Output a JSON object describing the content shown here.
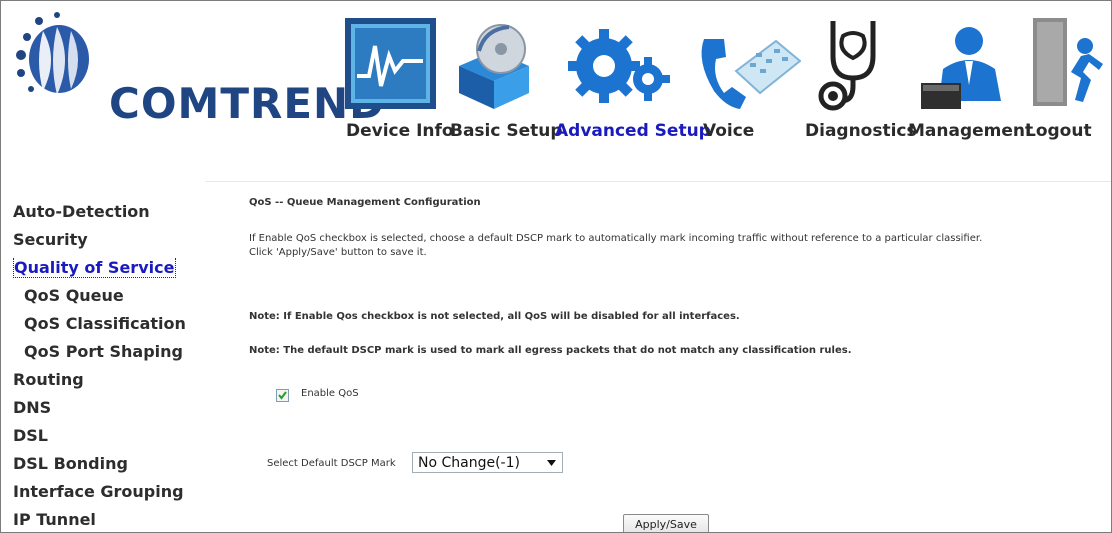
{
  "brand": {
    "name": "COMTREND",
    "color": "#1f4583"
  },
  "nav": {
    "items": [
      {
        "label": "Device Info",
        "icon": "monitor-chart-icon"
      },
      {
        "label": "Basic Setup",
        "icon": "disc-box-icon"
      },
      {
        "label": "Advanced Setup",
        "icon": "gears-icon",
        "active": true
      },
      {
        "label": "Voice",
        "icon": "telephone-icon"
      },
      {
        "label": "Diagnostics",
        "icon": "stethoscope-icon"
      },
      {
        "label": "Management",
        "icon": "admin-user-icon"
      },
      {
        "label": "Logout",
        "icon": "exit-door-icon"
      }
    ],
    "active_color": "#1a1bbf"
  },
  "sidebar": {
    "items": [
      {
        "label": "Auto-Detection"
      },
      {
        "label": "Security"
      },
      {
        "label": "Quality of Service",
        "active": true
      },
      {
        "label": "QoS Queue",
        "sub": true
      },
      {
        "label": "QoS Classification",
        "sub": true
      },
      {
        "label": "QoS Port Shaping",
        "sub": true
      },
      {
        "label": "Routing"
      },
      {
        "label": "DNS"
      },
      {
        "label": "DSL"
      },
      {
        "label": "DSL Bonding"
      },
      {
        "label": "Interface Grouping"
      },
      {
        "label": "IP Tunnel"
      }
    ]
  },
  "content": {
    "title": "QoS -- Queue Management Configuration",
    "description_line1": "If Enable QoS checkbox is selected, choose a default DSCP mark to automatically mark incoming traffic without reference to a particular classifier.",
    "description_line2": "Click 'Apply/Save' button to save it.",
    "note1": "Note: If Enable Qos checkbox is not selected, all QoS will be disabled for all interfaces.",
    "note2": "Note: The default DSCP mark is used to mark all egress packets that do not match any classification rules.",
    "enable_qos": {
      "label": "Enable QoS",
      "checked": true
    },
    "dscp": {
      "label": "Select Default DSCP Mark",
      "value": "No Change(-1)"
    },
    "apply_button": "Apply/Save"
  }
}
